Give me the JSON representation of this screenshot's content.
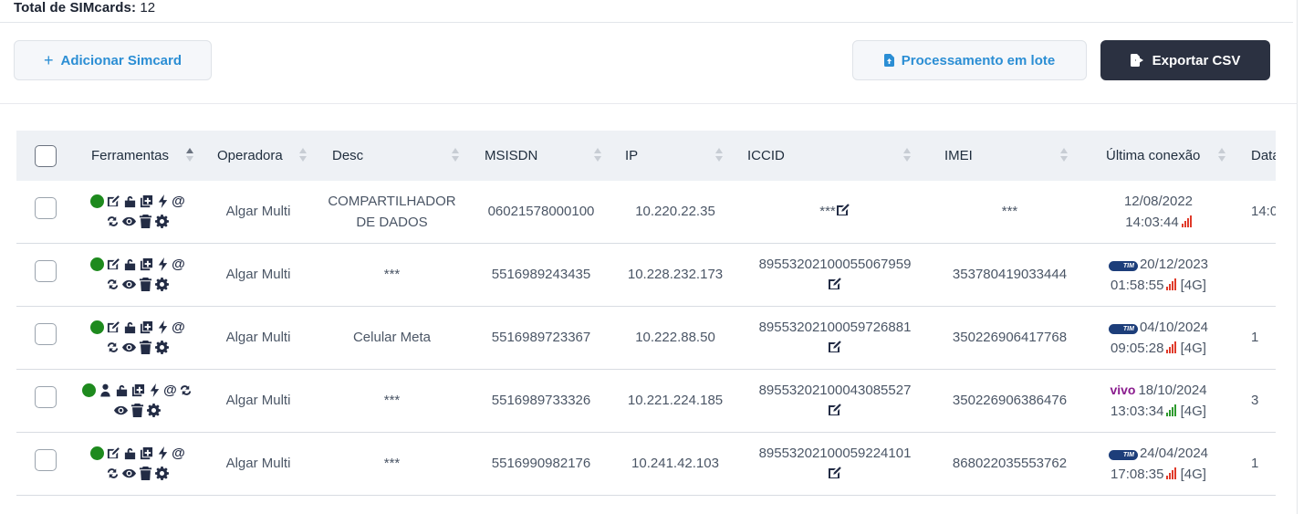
{
  "header": {
    "total_label": "Total de SIMcards:",
    "total_count": "12"
  },
  "toolbar": {
    "add_label": "Adicionar Simcard",
    "batch_label": "Processamento em lote",
    "export_label": "Exportar CSV"
  },
  "table": {
    "columns": [
      "Ferramentas",
      "Operadora",
      "Desc",
      "MSISDN",
      "IP",
      "ICCID",
      "IMEI",
      "Última conexão",
      "Data"
    ],
    "rows": [
      {
        "operadora": "Algar Multi",
        "desc": "COMPARTILHADOR DE DADOS",
        "msisdn": "06021578000100",
        "ip": "10.220.22.35",
        "iccid": "***",
        "imei": "***",
        "conn_date": "12/08/2022",
        "conn_time": "14:03:44",
        "conn_net": "",
        "carrier_logo": "",
        "signal": "red",
        "data_partial": "14:0"
      },
      {
        "operadora": "Algar Multi",
        "desc": "***",
        "msisdn": "5516989243435",
        "ip": "10.228.232.173",
        "iccid": "89553202100055067959",
        "imei": "353780419033444",
        "conn_date": "20/12/2023",
        "conn_time": "01:58:55",
        "conn_net": "[4G]",
        "carrier_logo": "TIM",
        "signal": "red",
        "data_partial": ""
      },
      {
        "operadora": "Algar Multi",
        "desc": "Celular Meta",
        "msisdn": "5516989723367",
        "ip": "10.222.88.50",
        "iccid": "89553202100059726881",
        "imei": "350226906417768",
        "conn_date": "04/10/2024",
        "conn_time": "09:05:28",
        "conn_net": "[4G]",
        "carrier_logo": "TIM",
        "signal": "red",
        "data_partial": "1"
      },
      {
        "operadora": "Algar Multi",
        "desc": "***",
        "msisdn": "5516989733326",
        "ip": "10.221.224.185",
        "iccid": "89553202100043085527",
        "imei": "350226906386476",
        "conn_date": "18/10/2024",
        "conn_time": "13:03:34",
        "conn_net": "[4G]",
        "carrier_logo": "vivo",
        "signal": "green",
        "data_partial": "3"
      },
      {
        "operadora": "Algar Multi",
        "desc": "***",
        "msisdn": "5516990982176",
        "ip": "10.241.42.103",
        "iccid": "89553202100059224101",
        "imei": "868022035553762",
        "conn_date": "24/04/2024",
        "conn_time": "17:08:35",
        "conn_net": "[4G]",
        "carrier_logo": "TIM",
        "signal": "red",
        "data_partial": "1"
      }
    ]
  },
  "colors": {
    "accent_blue": "#2b8ed4",
    "dark_button": "#2b3141",
    "status_green": "#1e8a1e",
    "signal_red": "#e03a2a",
    "signal_green": "#2e9a2e"
  }
}
